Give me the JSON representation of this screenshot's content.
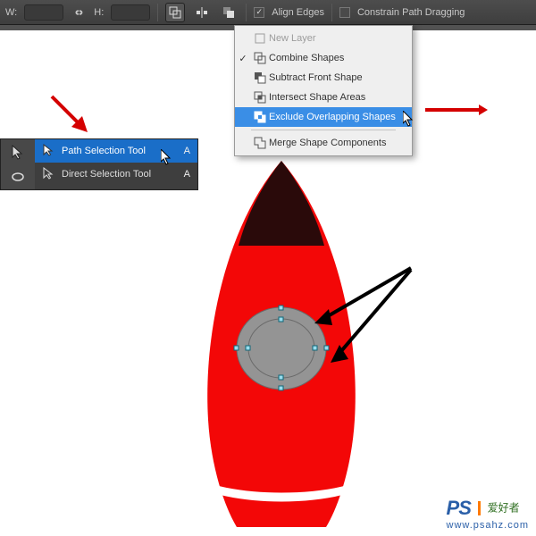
{
  "optionsBar": {
    "w_label": "W:",
    "h_label": "H:",
    "align_edges_label": "Align Edges",
    "constrain_label": "Constrain Path Dragging"
  },
  "dropdown": {
    "new_layer": "New Layer",
    "combine": "Combine Shapes",
    "subtract": "Subtract Front Shape",
    "intersect": "Intersect Shape Areas",
    "exclude": "Exclude Overlapping Shapes",
    "merge": "Merge Shape Components"
  },
  "flyout": {
    "path": "Path Selection Tool",
    "direct": "Direct Selection Tool",
    "key_a": "A"
  },
  "watermark": {
    "brand_ps": "PS",
    "brand_cn": "爱好者",
    "url": "www.psahz.com"
  }
}
